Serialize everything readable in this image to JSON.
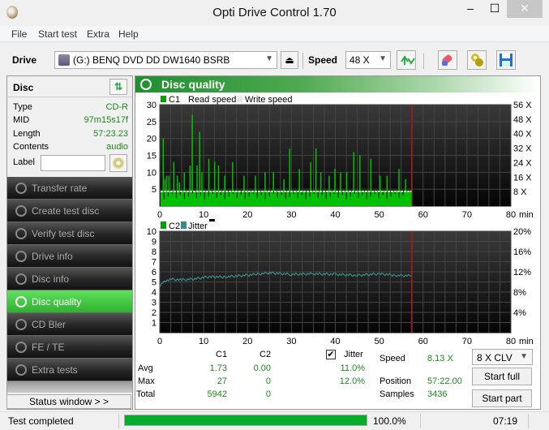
{
  "window": {
    "title": "Opti Drive Control 1.70",
    "min": "–",
    "max": "☐",
    "close": "✕"
  },
  "menu": [
    "File",
    "Start test",
    "Extra",
    "Help"
  ],
  "toolbar": {
    "drive_label": "Drive",
    "drive_value": "(G:)   BENQ DVD DD DW1640 BSRB",
    "speed_label": "Speed",
    "speed_value": "48 X",
    "eject": "⏏"
  },
  "disc": {
    "title": "Disc",
    "rows": [
      {
        "key": "Type",
        "value": "CD-R"
      },
      {
        "key": "MID",
        "value": "97m15s17f"
      },
      {
        "key": "Length",
        "value": "57:23.23"
      },
      {
        "key": "Contents",
        "value": "audio"
      }
    ],
    "label_key": "Label",
    "label_value": ""
  },
  "nav": [
    {
      "label": "Transfer rate",
      "active": false
    },
    {
      "label": "Create test disc",
      "active": false
    },
    {
      "label": "Verify test disc",
      "active": false
    },
    {
      "label": "Drive info",
      "active": false
    },
    {
      "label": "Disc info",
      "active": false
    },
    {
      "label": "Disc quality",
      "active": true
    },
    {
      "label": "CD Bler",
      "active": false
    },
    {
      "label": "FE / TE",
      "active": false
    },
    {
      "label": "Extra tests",
      "active": false
    }
  ],
  "status_window_button": "Status window > >",
  "panel_title": "Disc quality",
  "chart_data": [
    {
      "type": "bar",
      "title": "C1 / Read speed",
      "legend": [
        "C1",
        "Read speed",
        "Write speed"
      ],
      "xlabel": "min",
      "xlim": [
        0,
        80
      ],
      "xticks": [
        0,
        10,
        20,
        30,
        40,
        50,
        60,
        70,
        80
      ],
      "ylim": [
        0,
        30
      ],
      "yticks": [
        5,
        10,
        15,
        20,
        25,
        30
      ],
      "y2ticks": [
        "8 X",
        "16 X",
        "24 X",
        "32 X",
        "40 X",
        "48 X",
        "56 X"
      ],
      "y2lim": [
        0,
        56
      ],
      "end_position_min": 57.37,
      "read_speed_x": 8.13,
      "c1_peaks": [
        {
          "x": 0.8,
          "y": 20
        },
        {
          "x": 1.2,
          "y": 8
        },
        {
          "x": 1.6,
          "y": 9
        },
        {
          "x": 2.1,
          "y": 9
        },
        {
          "x": 3.2,
          "y": 13
        },
        {
          "x": 4.0,
          "y": 9
        },
        {
          "x": 4.5,
          "y": 7
        },
        {
          "x": 5.6,
          "y": 10
        },
        {
          "x": 6.9,
          "y": 12
        },
        {
          "x": 7.4,
          "y": 27
        },
        {
          "x": 8.5,
          "y": 12
        },
        {
          "x": 9.1,
          "y": 22
        },
        {
          "x": 9.6,
          "y": 10
        },
        {
          "x": 11.2,
          "y": 14
        },
        {
          "x": 12.5,
          "y": 13
        },
        {
          "x": 13.4,
          "y": 12
        },
        {
          "x": 14.8,
          "y": 9
        },
        {
          "x": 16.6,
          "y": 13
        },
        {
          "x": 19.2,
          "y": 9
        },
        {
          "x": 21.8,
          "y": 9
        },
        {
          "x": 24.0,
          "y": 10
        },
        {
          "x": 25.9,
          "y": 10
        },
        {
          "x": 28.3,
          "y": 8
        },
        {
          "x": 29.6,
          "y": 17
        },
        {
          "x": 31.8,
          "y": 11
        },
        {
          "x": 34.4,
          "y": 13
        },
        {
          "x": 35.6,
          "y": 17
        },
        {
          "x": 36.7,
          "y": 10
        },
        {
          "x": 38.6,
          "y": 9
        },
        {
          "x": 39.9,
          "y": 11
        },
        {
          "x": 41.2,
          "y": 10
        },
        {
          "x": 42.6,
          "y": 10
        },
        {
          "x": 44.2,
          "y": 16
        },
        {
          "x": 45.6,
          "y": 15
        },
        {
          "x": 48.1,
          "y": 14
        },
        {
          "x": 50.2,
          "y": 9
        },
        {
          "x": 51.8,
          "y": 9
        },
        {
          "x": 54.5,
          "y": 11
        },
        {
          "x": 56.0,
          "y": 8
        }
      ],
      "c1_avg": 1.73,
      "c1_max": 27,
      "c1_total": 5942
    },
    {
      "type": "line",
      "title": "C2 / Jitter",
      "legend": [
        "C2",
        "Jitter"
      ],
      "xlabel": "min",
      "xlim": [
        0,
        80
      ],
      "xticks": [
        0,
        10,
        20,
        30,
        40,
        50,
        60,
        70,
        80
      ],
      "ylim": [
        0,
        10
      ],
      "yticks": [
        1,
        2,
        3,
        4,
        5,
        6,
        7,
        8,
        9,
        10
      ],
      "y2ticks": [
        "4%",
        "8%",
        "12%",
        "16%",
        "20%"
      ],
      "y2lim": [
        0,
        20
      ],
      "end_position_min": 57.37,
      "jitter_percent": [
        {
          "x": 0,
          "y": 9.2
        },
        {
          "x": 1,
          "y": 10.2
        },
        {
          "x": 3,
          "y": 10.5
        },
        {
          "x": 5,
          "y": 10.4
        },
        {
          "x": 8,
          "y": 10.6
        },
        {
          "x": 11,
          "y": 11.0
        },
        {
          "x": 15,
          "y": 11.0
        },
        {
          "x": 18,
          "y": 11.2
        },
        {
          "x": 22,
          "y": 11.5
        },
        {
          "x": 25,
          "y": 11.8
        },
        {
          "x": 30,
          "y": 11.5
        },
        {
          "x": 35,
          "y": 11.6
        },
        {
          "x": 40,
          "y": 11.5
        },
        {
          "x": 45,
          "y": 11.3
        },
        {
          "x": 50,
          "y": 11.6
        },
        {
          "x": 54,
          "y": 11.3
        },
        {
          "x": 57.3,
          "y": 11.2
        }
      ],
      "c2_avg": 0.0,
      "c2_max": 0,
      "c2_total": 0
    }
  ],
  "stats": {
    "col_c1": "C1",
    "col_c2": "C2",
    "col_jitter": "Jitter",
    "jitter_checked": true,
    "rows": [
      {
        "label": "Avg",
        "c1": "1.73",
        "c2": "0.00",
        "jitter": "11.0%"
      },
      {
        "label": "Max",
        "c1": "27",
        "c2": "0",
        "jitter": "12.0%"
      },
      {
        "label": "Total",
        "c1": "5942",
        "c2": "0",
        "jitter": ""
      }
    ],
    "speed_label": "Speed",
    "speed_value": "8.13 X",
    "position_label": "Position",
    "position_value": "57:22.00",
    "samples_label": "Samples",
    "samples_value": "3436",
    "mode_value": "8 X CLV",
    "start_full": "Start full",
    "start_part": "Start part"
  },
  "statusbar": {
    "text": "Test completed",
    "progress": 1.0,
    "percent": "100.0%",
    "time": "07:19"
  },
  "colors": {
    "c1": "#00c000",
    "jitter": "#3a8a8a",
    "marker": "#e00000",
    "progress": "#06ad2a",
    "value_text": "#1a8a1a"
  }
}
